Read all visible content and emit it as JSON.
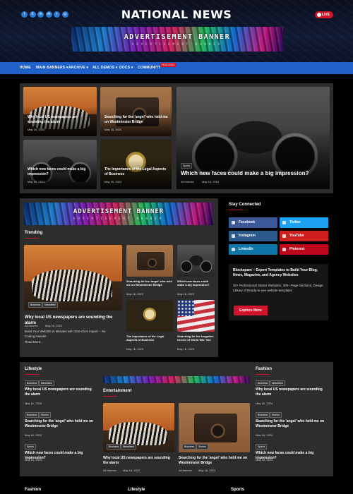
{
  "header": {
    "site_title": "NATIONAL NEWS",
    "live_label": "LIVE",
    "social_icons": [
      "facebook-icon",
      "x-icon",
      "linkedin-icon",
      "vk-icon",
      "telegram-icon",
      "instagram-icon"
    ],
    "social_glyphs": [
      "f",
      "X",
      "in",
      "vk",
      "t",
      "◎"
    ]
  },
  "ad": {
    "title": "ADVERTISEMENT BANNER",
    "subtitle": "ADVERTISEMENT BANNER"
  },
  "nav": {
    "items": [
      "HOME",
      "MAIN BANNERS ▾",
      "ARCHIVE ▾",
      "ALL DEMOS ▾",
      "DOCS ▾",
      "COMMUNITY"
    ],
    "new_badge": "FEATURED"
  },
  "grid": {
    "a": {
      "title": "Why local US newspapers are sounding the alarm",
      "meta": "May 16, 2024"
    },
    "b": {
      "title": "Searching for the 'angel' who held me on Westminster Bridge",
      "meta": "May 16, 2024"
    },
    "c": {
      "title": "Which new faces could make a big impression?",
      "meta": "May 16, 2024"
    },
    "d": {
      "title": "The Importance of the Legal Aspects of Business",
      "meta": "May 16, 2024"
    },
    "big": {
      "tag": "Sports",
      "title": "Which new faces could make a big impression?",
      "meta": "All themes",
      "date": "May 16, 2024"
    }
  },
  "trending": {
    "heading": "Trending",
    "main": {
      "tags": [
        "Business",
        "Newsfeed"
      ],
      "title": "Why local US newspapers are sounding the alarm",
      "author": "All themes",
      "date": "May 16, 2024",
      "excerpt": "Build Your Website in Minutes with One-Click Import – No Coding Hassle!",
      "read_more": "Read More.."
    },
    "items": [
      {
        "title": "Searching for the 'angel' who held me on Westminster Bridge",
        "date": "May 16, 2024"
      },
      {
        "title": "Which new faces could make a big impression?",
        "date": "May 16, 2024"
      },
      {
        "title": "The Importance of the Legal Aspects of Business",
        "date": "May 16, 2024"
      },
      {
        "title": "Searching for the forgotten heroes of World War Two",
        "date": "May 16, 2024"
      }
    ]
  },
  "stay": {
    "heading": "Stay Connected",
    "buttons": [
      "Facebook",
      "Twitter",
      "Instagram",
      "YouTube",
      "LinkedIn",
      "Pinterest"
    ],
    "promo_title": "Blockspare – Expert Templates to Build Your Blog, News, Magazine, and Agency Websites",
    "promo_text": "30+ Professional Starter Websites, 300+ Page Sections, Design Library of Ready-to-use website templates",
    "promo_button": "Explore More"
  },
  "lifestyle": {
    "heading": "Lifestyle",
    "items": [
      {
        "tags": [
          "Business",
          "Newsfeed"
        ],
        "title": "Why local US newspapers are sounding the alarm",
        "date": "May 16, 2024"
      },
      {
        "tags": [
          "Business",
          "Stories"
        ],
        "title": "Searching for the 'angel' who held me on Westminster Bridge",
        "date": "May 16, 2024"
      },
      {
        "tags": [
          "Sports"
        ],
        "title": "Which new faces could make a big impression?",
        "date": "May 16, 2024"
      }
    ]
  },
  "entertainment": {
    "heading": "Entertainment",
    "items": [
      {
        "tags": [
          "Business",
          "Newsfeed"
        ],
        "title": "Why local US newspapers are sounding the alarm",
        "author": "All themes",
        "date": "May 16, 2024"
      },
      {
        "tags": [
          "Business",
          "Stories"
        ],
        "title": "Searching for the 'angel' who held me on Westminster Bridge",
        "author": "All themes",
        "date": "May 16, 2024"
      }
    ]
  },
  "fashion": {
    "heading": "Fashion",
    "items": [
      {
        "tags": [
          "Business",
          "Newsfeed"
        ],
        "title": "Why local US newspapers are sounding the alarm",
        "date": "May 16, 2024"
      },
      {
        "tags": [
          "Business",
          "Stories"
        ],
        "title": "Searching for the 'angel' who held me on Westminster Bridge",
        "date": "May 16, 2024"
      },
      {
        "tags": [
          "Sports"
        ],
        "title": "Which new faces could make a big impression?",
        "date": "May 16, 2024"
      }
    ]
  },
  "bottom": {
    "headings": [
      "Fashion",
      "Lifestyle",
      "Sports"
    ]
  },
  "colors": {
    "nav": "#1f61c9",
    "accent": "#d0142a",
    "panel": "#2d2d2d"
  }
}
